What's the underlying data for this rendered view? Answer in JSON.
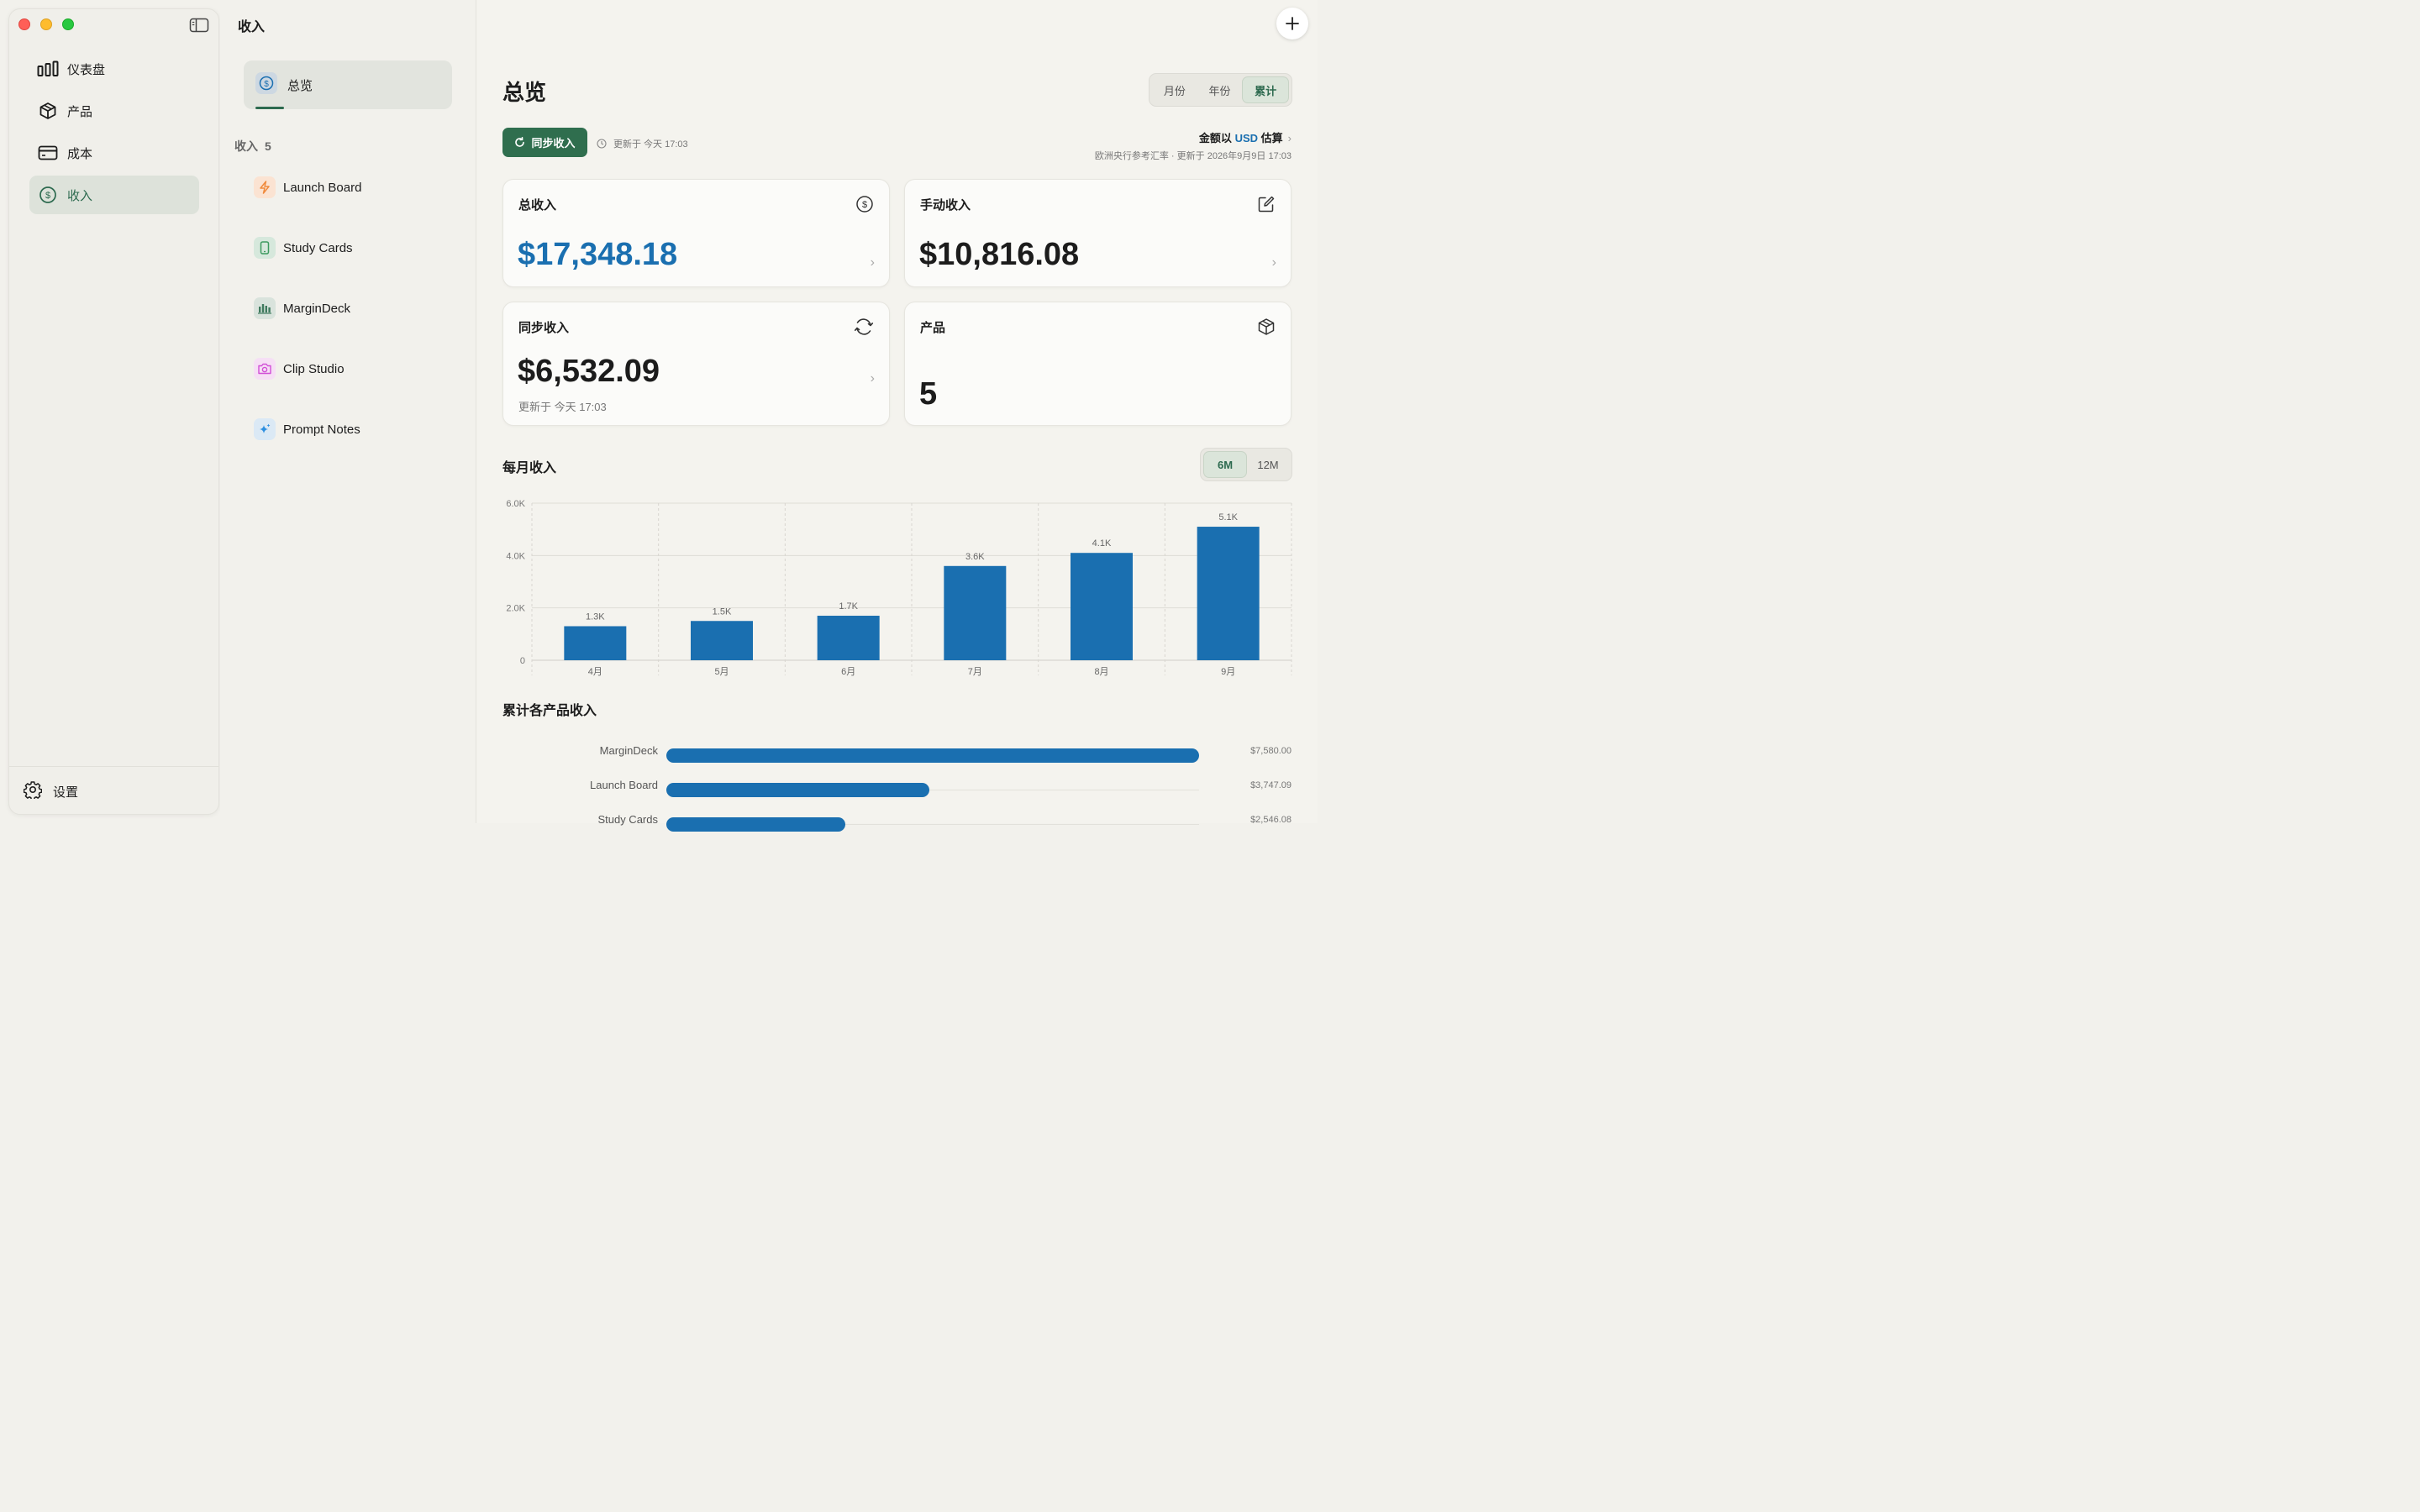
{
  "sidebar": {
    "items": [
      {
        "label": "仪表盘",
        "icon": "bar-chart-icon"
      },
      {
        "label": "产品",
        "icon": "box-icon"
      },
      {
        "label": "成本",
        "icon": "card-icon"
      },
      {
        "label": "收入",
        "icon": "dollar-circle-icon",
        "active": true
      }
    ],
    "settings_label": "设置"
  },
  "list": {
    "title": "收入",
    "overview_label": "总览",
    "section_label": "收入",
    "section_count": "5",
    "products": [
      {
        "name": "Launch Board",
        "icon": "bolt-icon",
        "color": "#f08a3c"
      },
      {
        "name": "Study Cards",
        "icon": "phone-icon",
        "color": "#3d9a5f"
      },
      {
        "name": "MarginDeck",
        "icon": "bars-icon",
        "color": "#3f7a5e"
      },
      {
        "name": "Clip Studio",
        "icon": "camera-icon",
        "color": "#d14fd6"
      },
      {
        "name": "Prompt Notes",
        "icon": "sparkle-icon",
        "color": "#2d8fe0"
      }
    ]
  },
  "main": {
    "title": "总览",
    "period_options": [
      "月份",
      "年份",
      "累计"
    ],
    "period_selected": "累计",
    "sync_label": "同步收入",
    "updated_text": "更新于 今天 17:03",
    "currency": {
      "prefix": "金额以",
      "code": "USD",
      "suffix": "估算",
      "note": "欧洲央行参考汇率 · 更新于 2026年9月9日 17:03"
    },
    "cards": {
      "total": {
        "title": "总收入",
        "value": "$17,348.18"
      },
      "manual": {
        "title": "手动收入",
        "value": "$10,816.08"
      },
      "synced": {
        "title": "同步收入",
        "value": "$6,532.09",
        "sub": "更新于 今天 17:03"
      },
      "products": {
        "title": "产品",
        "value": "5"
      }
    },
    "monthly_title": "每月收入",
    "range_options": [
      "6M",
      "12M"
    ],
    "range_selected": "6M",
    "cumulative_title": "累计各产品收入"
  },
  "chart_data": [
    {
      "type": "bar",
      "title": "每月收入",
      "categories": [
        "4月",
        "5月",
        "6月",
        "7月",
        "8月",
        "9月"
      ],
      "values": [
        1300,
        1500,
        1700,
        3600,
        4100,
        5100
      ],
      "data_labels": [
        "1.3K",
        "1.5K",
        "1.7K",
        "3.6K",
        "4.1K",
        "5.1K"
      ],
      "yticks": [
        "0",
        "2.0K",
        "4.0K",
        "6.0K"
      ],
      "ylim": [
        0,
        6000
      ],
      "color": "#1a6fb0"
    },
    {
      "type": "bar",
      "orientation": "horizontal",
      "title": "累计各产品收入",
      "categories": [
        "MarginDeck",
        "Launch Board",
        "Study Cards"
      ],
      "values": [
        7580.0,
        3747.09,
        2546.08
      ],
      "value_labels": [
        "$7,580.00",
        "$3,747.09",
        "$2,546.08"
      ],
      "xlim": [
        0,
        7580
      ],
      "color": "#1a6fb0"
    }
  ]
}
